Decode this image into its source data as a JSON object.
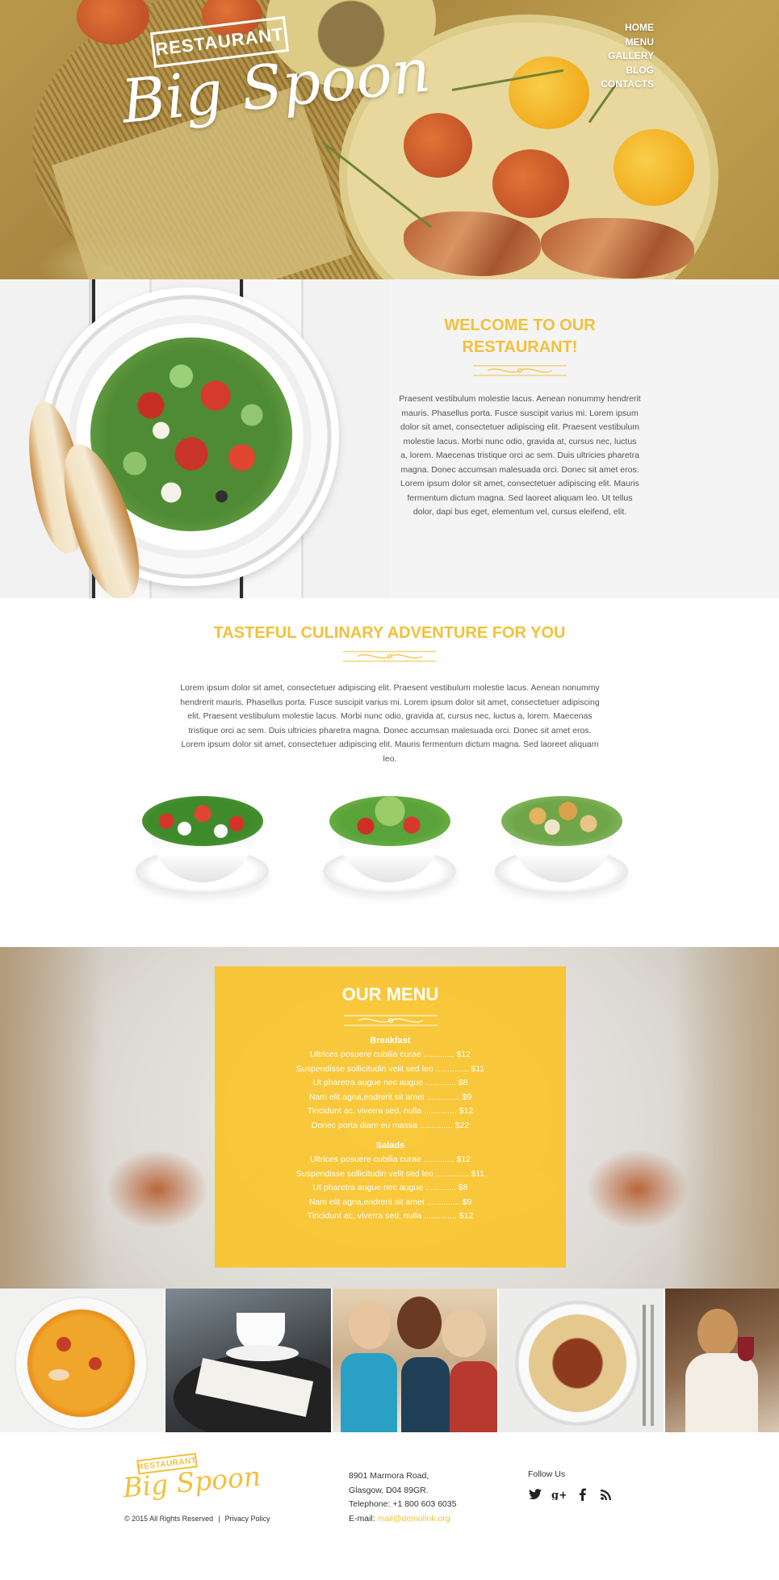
{
  "header": {
    "logo_badge": "RESTAURANT",
    "logo_script": "Big Spoon",
    "nav": [
      "HOME",
      "MENU",
      "GALLERY",
      "BLOG",
      "CONTACTS"
    ]
  },
  "welcome": {
    "title_line1": "WELCOME TO OUR",
    "title_line2": "RESTAURANT!",
    "text": "Praesent vestibulum molestie lacus. Aenean nonummy hendrerit mauris. Phasellus porta. Fusce suscipit varius mi. Lorem ipsum dolor sit amet, consectetuer adipiscing elit. Praesent vestibulum molestie lacus. Morbi nunc odio, gravida at, cursus nec, luctus a, lorem. Maecenas tristique orci ac sem. Duis ultricies pharetra magna. Donec accumsan malesuada orci. Donec sit amet eros. Lorem ipsum dolor sit amet, consectetuer adipiscing elit. Mauris fermentum dictum magna. Sed laoreet aliquam leo. Ut tellus dolor, dapi bus eget, elementum vel, cursus eleifend, elit."
  },
  "culinary": {
    "title": "TASTEFUL CULINARY ADVENTURE FOR YOU",
    "text": "Lorem ipsum dolor sit amet, consectetuer adipiscing elit. Praesent vestibulum molestie lacus. Aenean nonummy hendrerit mauris. Phasellus porta. Fusce suscipit varius mi. Lorem ipsum dolor sit amet, consectetuer adipiscing elit. Praesent vestibulum molestie lacus. Morbi nunc odio, gravida at, cursus nec, luctus a, lorem. Maecenas tristique orci ac sem. Duis ultricies pharetra magna. Donec accumsan malesuada orci. Donec sit amet eros. Lorem ipsum dolor sit amet, consectetuer adipiscing elit. Mauris fermentum dictum magna. Sed laoreet aliquam leo."
  },
  "menu": {
    "title": "OUR MENU",
    "sections": [
      {
        "name": "Breakfast",
        "items": [
          "Ultrices posuere cubilia curae ............. $12",
          "Suspendisse sollicitudin velit sed leo .............. $11",
          "Ut pharetra augue nec augue ............. $8",
          "Nam elit agna,endrerit sit amet .............. $9",
          "Tincidunt ac, viverra sed, nulla .............. $12",
          "Donec porta diam eu massa .............. $22"
        ]
      },
      {
        "name": "Salads",
        "items": [
          "Ultrices posuere cubilia curae ............. $12",
          "Suspendisse sollicitudin velit sed leo .............. $11",
          "Ut pharetra augue nec augue ............. $8",
          "Nam elit agna,endrerit sit amet .............. $9",
          "Tincidunt ac, viverra sed, nulla .............. $12"
        ]
      }
    ]
  },
  "footer": {
    "logo_badge": "RESTAURANT",
    "logo_script": "Big Spoon",
    "copyright": "© 2015 All Rights Reserved",
    "separator": "|",
    "privacy": "Privacy Policy",
    "address_line1": "8901 Marmora Road,",
    "address_line2": "Glasgow, D04 89GR.",
    "telephone_label": "Telephone:",
    "telephone": "+1 800 603 6035",
    "email_label": "E-mail:",
    "email": "mail@demolink.org",
    "follow_label": "Follow Us",
    "social_icons": [
      "twitter-icon",
      "google-plus-icon",
      "facebook-icon",
      "rss-icon"
    ]
  },
  "colors": {
    "accent": "#f2c13a",
    "menu_panel": "#f9c328"
  }
}
